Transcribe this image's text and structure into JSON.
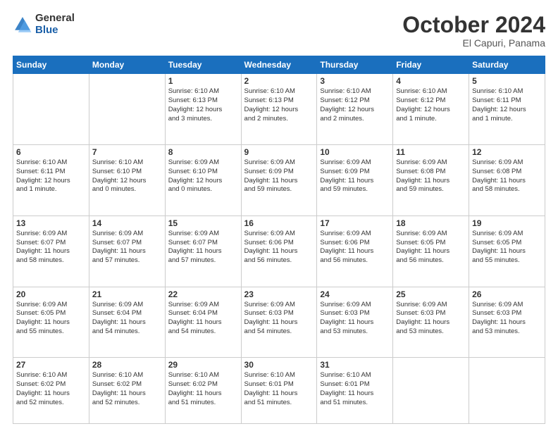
{
  "header": {
    "logo_line1": "General",
    "logo_line2": "Blue",
    "month": "October 2024",
    "location": "El Capuri, Panama"
  },
  "weekdays": [
    "Sunday",
    "Monday",
    "Tuesday",
    "Wednesday",
    "Thursday",
    "Friday",
    "Saturday"
  ],
  "weeks": [
    [
      {
        "day": "",
        "info": ""
      },
      {
        "day": "",
        "info": ""
      },
      {
        "day": "1",
        "info": "Sunrise: 6:10 AM\nSunset: 6:13 PM\nDaylight: 12 hours\nand 3 minutes."
      },
      {
        "day": "2",
        "info": "Sunrise: 6:10 AM\nSunset: 6:13 PM\nDaylight: 12 hours\nand 2 minutes."
      },
      {
        "day": "3",
        "info": "Sunrise: 6:10 AM\nSunset: 6:12 PM\nDaylight: 12 hours\nand 2 minutes."
      },
      {
        "day": "4",
        "info": "Sunrise: 6:10 AM\nSunset: 6:12 PM\nDaylight: 12 hours\nand 1 minute."
      },
      {
        "day": "5",
        "info": "Sunrise: 6:10 AM\nSunset: 6:11 PM\nDaylight: 12 hours\nand 1 minute."
      }
    ],
    [
      {
        "day": "6",
        "info": "Sunrise: 6:10 AM\nSunset: 6:11 PM\nDaylight: 12 hours\nand 1 minute."
      },
      {
        "day": "7",
        "info": "Sunrise: 6:10 AM\nSunset: 6:10 PM\nDaylight: 12 hours\nand 0 minutes."
      },
      {
        "day": "8",
        "info": "Sunrise: 6:09 AM\nSunset: 6:10 PM\nDaylight: 12 hours\nand 0 minutes."
      },
      {
        "day": "9",
        "info": "Sunrise: 6:09 AM\nSunset: 6:09 PM\nDaylight: 11 hours\nand 59 minutes."
      },
      {
        "day": "10",
        "info": "Sunrise: 6:09 AM\nSunset: 6:09 PM\nDaylight: 11 hours\nand 59 minutes."
      },
      {
        "day": "11",
        "info": "Sunrise: 6:09 AM\nSunset: 6:08 PM\nDaylight: 11 hours\nand 59 minutes."
      },
      {
        "day": "12",
        "info": "Sunrise: 6:09 AM\nSunset: 6:08 PM\nDaylight: 11 hours\nand 58 minutes."
      }
    ],
    [
      {
        "day": "13",
        "info": "Sunrise: 6:09 AM\nSunset: 6:07 PM\nDaylight: 11 hours\nand 58 minutes."
      },
      {
        "day": "14",
        "info": "Sunrise: 6:09 AM\nSunset: 6:07 PM\nDaylight: 11 hours\nand 57 minutes."
      },
      {
        "day": "15",
        "info": "Sunrise: 6:09 AM\nSunset: 6:07 PM\nDaylight: 11 hours\nand 57 minutes."
      },
      {
        "day": "16",
        "info": "Sunrise: 6:09 AM\nSunset: 6:06 PM\nDaylight: 11 hours\nand 56 minutes."
      },
      {
        "day": "17",
        "info": "Sunrise: 6:09 AM\nSunset: 6:06 PM\nDaylight: 11 hours\nand 56 minutes."
      },
      {
        "day": "18",
        "info": "Sunrise: 6:09 AM\nSunset: 6:05 PM\nDaylight: 11 hours\nand 56 minutes."
      },
      {
        "day": "19",
        "info": "Sunrise: 6:09 AM\nSunset: 6:05 PM\nDaylight: 11 hours\nand 55 minutes."
      }
    ],
    [
      {
        "day": "20",
        "info": "Sunrise: 6:09 AM\nSunset: 6:05 PM\nDaylight: 11 hours\nand 55 minutes."
      },
      {
        "day": "21",
        "info": "Sunrise: 6:09 AM\nSunset: 6:04 PM\nDaylight: 11 hours\nand 54 minutes."
      },
      {
        "day": "22",
        "info": "Sunrise: 6:09 AM\nSunset: 6:04 PM\nDaylight: 11 hours\nand 54 minutes."
      },
      {
        "day": "23",
        "info": "Sunrise: 6:09 AM\nSunset: 6:03 PM\nDaylight: 11 hours\nand 54 minutes."
      },
      {
        "day": "24",
        "info": "Sunrise: 6:09 AM\nSunset: 6:03 PM\nDaylight: 11 hours\nand 53 minutes."
      },
      {
        "day": "25",
        "info": "Sunrise: 6:09 AM\nSunset: 6:03 PM\nDaylight: 11 hours\nand 53 minutes."
      },
      {
        "day": "26",
        "info": "Sunrise: 6:09 AM\nSunset: 6:03 PM\nDaylight: 11 hours\nand 53 minutes."
      }
    ],
    [
      {
        "day": "27",
        "info": "Sunrise: 6:10 AM\nSunset: 6:02 PM\nDaylight: 11 hours\nand 52 minutes."
      },
      {
        "day": "28",
        "info": "Sunrise: 6:10 AM\nSunset: 6:02 PM\nDaylight: 11 hours\nand 52 minutes."
      },
      {
        "day": "29",
        "info": "Sunrise: 6:10 AM\nSunset: 6:02 PM\nDaylight: 11 hours\nand 51 minutes."
      },
      {
        "day": "30",
        "info": "Sunrise: 6:10 AM\nSunset: 6:01 PM\nDaylight: 11 hours\nand 51 minutes."
      },
      {
        "day": "31",
        "info": "Sunrise: 6:10 AM\nSunset: 6:01 PM\nDaylight: 11 hours\nand 51 minutes."
      },
      {
        "day": "",
        "info": ""
      },
      {
        "day": "",
        "info": ""
      }
    ]
  ]
}
